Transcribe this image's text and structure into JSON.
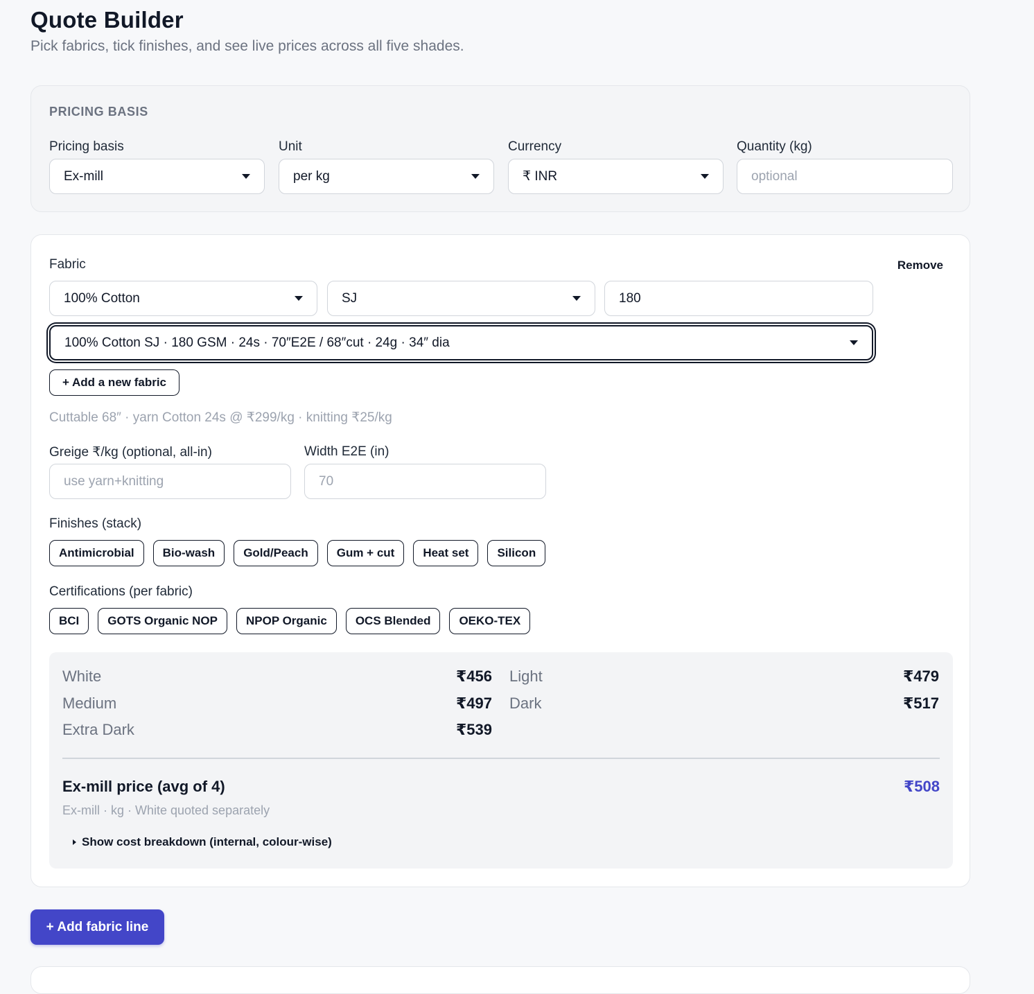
{
  "header": {
    "title": "Quote Builder",
    "subtitle": "Pick fabrics, tick finishes, and see live prices across all five shades."
  },
  "pricing_basis": {
    "section_title": "PRICING BASIS",
    "basis_label": "Pricing basis",
    "basis_value": "Ex-mill",
    "unit_label": "Unit",
    "unit_value": "per kg",
    "currency_label": "Currency",
    "currency_value": "₹ INR",
    "quantity_label": "Quantity (kg)",
    "quantity_placeholder": "optional"
  },
  "fabric": {
    "label": "Fabric",
    "remove_label": "Remove",
    "composition_value": "100% Cotton",
    "structure_value": "SJ",
    "gsm_value": "180",
    "variant_value": "100% Cotton SJ · 180 GSM · 24s · 70″E2E / 68″cut · 24g · 34″ dia",
    "add_new_label": "+ Add a new fabric",
    "meta": "Cuttable 68″ · yarn Cotton 24s @ ₹299/kg · knitting ₹25/kg",
    "greige_label": "Greige ₹/kg (optional, all-in)",
    "greige_placeholder": "use yarn+knitting",
    "width_label": "Width E2E (in)",
    "width_placeholder": "70",
    "finishes_label": "Finishes (stack)",
    "finishes": [
      "Antimicrobial",
      "Bio-wash",
      "Gold/Peach",
      "Gum + cut",
      "Heat set",
      "Silicon"
    ],
    "certs_label": "Certifications (per fabric)",
    "certifications": [
      "BCI",
      "GOTS Organic NOP",
      "NPOP Organic",
      "OCS Blended",
      "OEKO-TEX"
    ]
  },
  "prices": {
    "shades": [
      {
        "name": "White",
        "value": "₹456"
      },
      {
        "name": "Light",
        "value": "₹479"
      },
      {
        "name": "Medium",
        "value": "₹497"
      },
      {
        "name": "Dark",
        "value": "₹517"
      },
      {
        "name": "Extra Dark",
        "value": "₹539"
      }
    ],
    "avg_label": "Ex-mill price (avg of 4)",
    "avg_value": "₹508",
    "avg_note": "Ex-mill · kg · White quoted separately",
    "breakdown_label": "Show cost breakdown (internal, colour-wise)"
  },
  "actions": {
    "add_line_label": "+ Add fabric line"
  },
  "colors": {
    "accent": "#4346c8",
    "text": "#111827",
    "muted": "#6b7280"
  }
}
